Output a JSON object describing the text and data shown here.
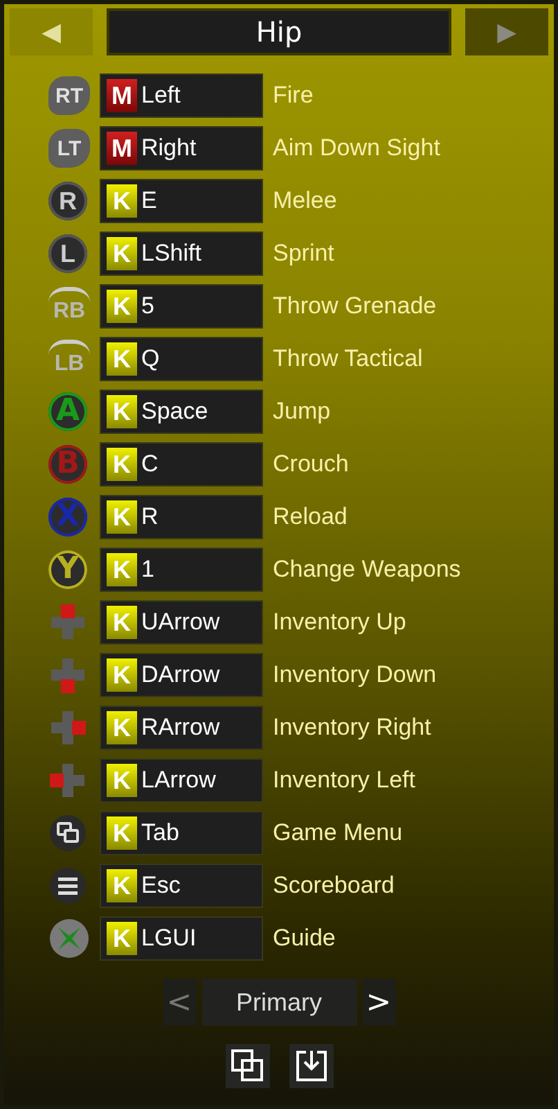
{
  "header": {
    "prev": {
      "glyph": "◀",
      "disabled": true
    },
    "title": "Hip",
    "next": {
      "glyph": "▶",
      "disabled": false
    }
  },
  "bindings": [
    {
      "icon": {
        "kind": "trigger",
        "label": "RT"
      },
      "source": {
        "kind": "mouse",
        "label": "M"
      },
      "key": "Left",
      "action": "Fire"
    },
    {
      "icon": {
        "kind": "trigger",
        "label": "LT"
      },
      "source": {
        "kind": "mouse",
        "label": "M"
      },
      "key": "Right",
      "action": "Aim Down Sight"
    },
    {
      "icon": {
        "kind": "stick",
        "label": "R"
      },
      "source": {
        "kind": "keyboard",
        "label": "K"
      },
      "key": "E",
      "action": "Melee"
    },
    {
      "icon": {
        "kind": "stick",
        "label": "L"
      },
      "source": {
        "kind": "keyboard",
        "label": "K"
      },
      "key": "LShift",
      "action": "Sprint"
    },
    {
      "icon": {
        "kind": "bumper",
        "label": "RB"
      },
      "source": {
        "kind": "keyboard",
        "label": "K"
      },
      "key": "5",
      "action": "Throw Grenade"
    },
    {
      "icon": {
        "kind": "bumper",
        "label": "LB"
      },
      "source": {
        "kind": "keyboard",
        "label": "K"
      },
      "key": "Q",
      "action": "Throw Tactical"
    },
    {
      "icon": {
        "kind": "face",
        "label": "A",
        "color": "#1a9a1a"
      },
      "source": {
        "kind": "keyboard",
        "label": "K"
      },
      "key": "Space",
      "action": "Jump"
    },
    {
      "icon": {
        "kind": "face",
        "label": "B",
        "color": "#a01818"
      },
      "source": {
        "kind": "keyboard",
        "label": "K"
      },
      "key": "C",
      "action": "Crouch"
    },
    {
      "icon": {
        "kind": "face",
        "label": "X",
        "color": "#1828a8"
      },
      "source": {
        "kind": "keyboard",
        "label": "K"
      },
      "key": "R",
      "action": "Reload"
    },
    {
      "icon": {
        "kind": "face",
        "label": "Y",
        "color": "#b8b020"
      },
      "source": {
        "kind": "keyboard",
        "label": "K"
      },
      "key": "1",
      "action": "Change Weapons"
    },
    {
      "icon": {
        "kind": "dpad-up"
      },
      "source": {
        "kind": "keyboard",
        "label": "K"
      },
      "key": "UArrow",
      "action": "Inventory Up"
    },
    {
      "icon": {
        "kind": "dpad-down"
      },
      "source": {
        "kind": "keyboard",
        "label": "K"
      },
      "key": "DArrow",
      "action": "Inventory Down"
    },
    {
      "icon": {
        "kind": "dpad-right"
      },
      "source": {
        "kind": "keyboard",
        "label": "K"
      },
      "key": "RArrow",
      "action": "Inventory Right"
    },
    {
      "icon": {
        "kind": "dpad-left"
      },
      "source": {
        "kind": "keyboard",
        "label": "K"
      },
      "key": "LArrow",
      "action": "Inventory Left"
    },
    {
      "icon": {
        "kind": "view"
      },
      "source": {
        "kind": "keyboard",
        "label": "K"
      },
      "key": "Tab",
      "action": "Game Menu"
    },
    {
      "icon": {
        "kind": "menu"
      },
      "source": {
        "kind": "keyboard",
        "label": "K"
      },
      "key": "Esc",
      "action": "Scoreboard"
    },
    {
      "icon": {
        "kind": "guide"
      },
      "source": {
        "kind": "keyboard",
        "label": "K"
      },
      "key": "LGUI",
      "action": "Guide"
    }
  ],
  "pager": {
    "prev": {
      "glyph": "<",
      "disabled": true
    },
    "label": "Primary",
    "next": {
      "glyph": ">",
      "disabled": false
    }
  }
}
